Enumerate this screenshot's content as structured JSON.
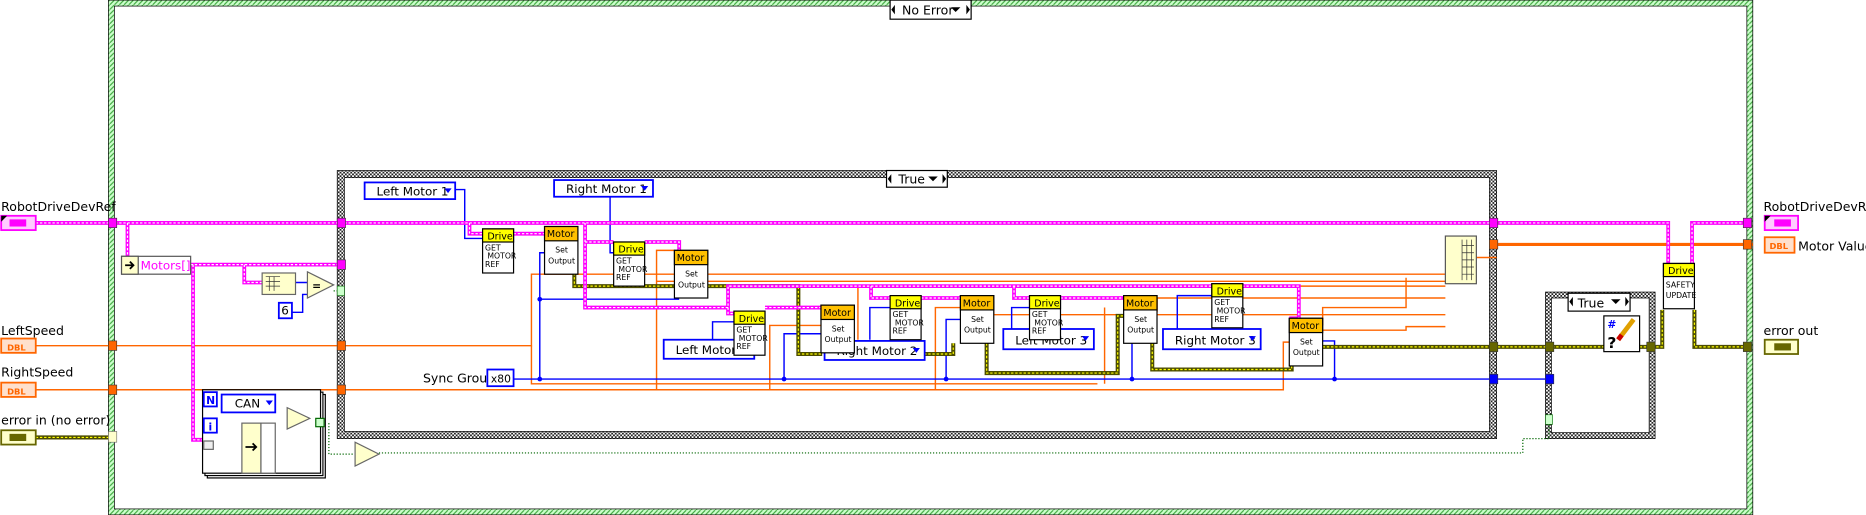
{
  "outer_case": {
    "selector": "No Error"
  },
  "inner_case": {
    "selector": "True"
  },
  "small_case": {
    "selector": "True"
  },
  "inputs": {
    "robot_drive_ref": "RobotDriveDevRef",
    "left_speed": "LeftSpeed",
    "right_speed": "RightSpeed",
    "error_in": "error in (no error)"
  },
  "outputs": {
    "robot_drive_ref": "RobotDriveDevRef",
    "motor_values": "Motor Values",
    "error_out": "error out"
  },
  "terminal_types": {
    "dbl": "DBL"
  },
  "motors_unbundle": "Motors[]",
  "constants": {
    "six": "6",
    "sync_group_label": "Sync Group",
    "sync_group_value": "x80",
    "can": "CAN"
  },
  "loop": {
    "n": "N",
    "i": "i"
  },
  "enums": [
    "Left Motor 1",
    "Right Motor 1",
    "Left Motor 2",
    "Right Motor 2",
    "Left Motor 3",
    "Right Motor 3"
  ],
  "drive_node": {
    "head": "Drive",
    "line1": "GET",
    "line2": "MOTOR",
    "line3": "REF"
  },
  "motor_node": {
    "head": "Motor",
    "line1": "Set",
    "line2": "Output"
  },
  "safety_node": {
    "head": "Drive",
    "line1": "SAFETY",
    "line2": "UPDATE"
  },
  "colors": {
    "refwire": "#ff00ff",
    "dblwire": "#ff6600",
    "intwire": "#0000ff",
    "errorwire": "#4d4d00",
    "drive_head": "#ffff00",
    "motor_head": "#ffc000",
    "case_border": "#66cc66"
  }
}
